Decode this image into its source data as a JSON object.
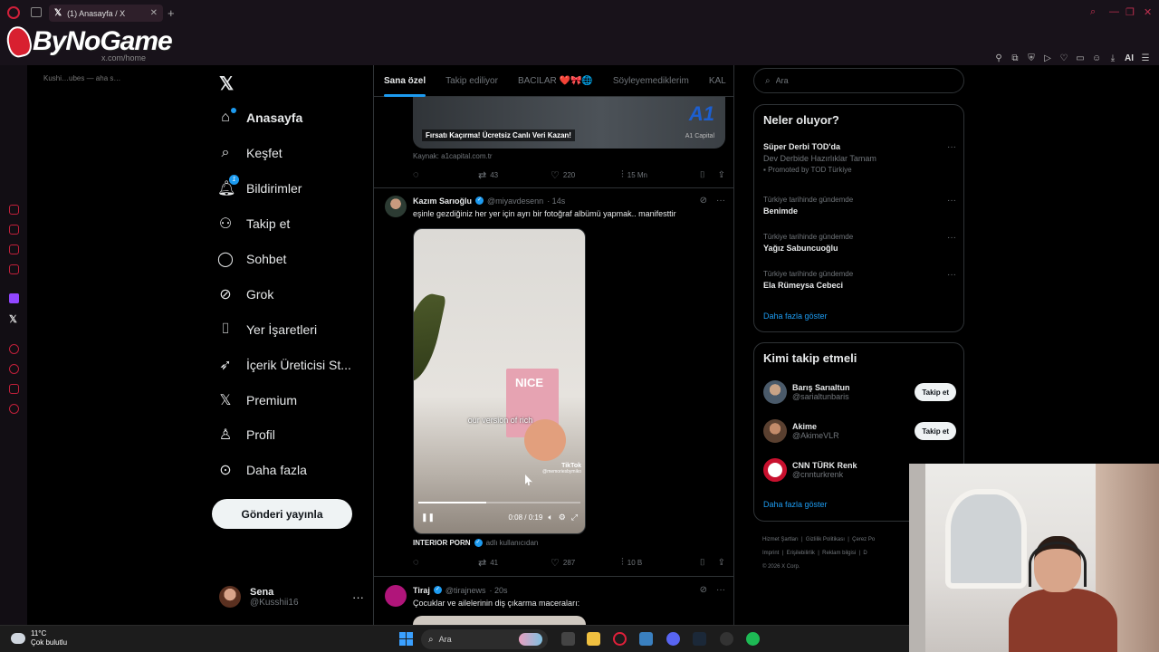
{
  "browser": {
    "tab_title": "(1) Anasayfa / X",
    "url": "x.com/home",
    "bookmark": "Kushi…ubes — aha s…",
    "brand": "ByNoGame",
    "ai_label": "AI"
  },
  "nav": {
    "items": [
      {
        "label": "Anasayfa",
        "icon": "home-icon"
      },
      {
        "label": "Keşfet",
        "icon": "search-icon"
      },
      {
        "label": "Bildirimler",
        "icon": "bell-icon",
        "badge": "1"
      },
      {
        "label": "Takip et",
        "icon": "add-person-icon"
      },
      {
        "label": "Sohbet",
        "icon": "chat-icon"
      },
      {
        "label": "Grok",
        "icon": "grok-icon"
      },
      {
        "label": "Yer İşaretleri",
        "icon": "bookmark-icon"
      },
      {
        "label": "İçerik Üreticisi St...",
        "icon": "rocket-icon"
      },
      {
        "label": "Premium",
        "icon": "x-icon"
      },
      {
        "label": "Profil",
        "icon": "person-icon"
      },
      {
        "label": "Daha fazla",
        "icon": "more-circle-icon"
      }
    ],
    "post_button": "Gönderi yayınla",
    "profile": {
      "name": "Sena",
      "handle": "@Kusshii16"
    }
  },
  "timeline": {
    "tabs": [
      "Sana özel",
      "Takip ediliyor",
      "BACILAR ❤️🎀🌐",
      "Söyleyemediklerim",
      "KAL"
    ],
    "ad": {
      "caption": "Fırsatı Kaçırma! Ücretsiz Canlı Veri Kazan!",
      "brand": "A1",
      "brand_sub": "A1 Capital",
      "source": "Kaynak: a1capital.com.tr",
      "replies": "",
      "reposts": "43",
      "likes": "220",
      "views": "15 Mn"
    },
    "tweet1": {
      "name": "Kazım Sarıoğlu",
      "handle": "@miyavdesenn",
      "time": "· 14s",
      "text": "eşinle gezdiğiniz her yer için ayrı bir fotoğraf albümü yapmak.. manifesttir",
      "video_overlay": "our version of rich",
      "video_book": "NICE",
      "tiktok": "TikTok",
      "tiktok_user": "@memoriesbymiko",
      "video_time": "0:08 / 0:19",
      "video_progress": 0.42,
      "credit_name": "INTERIOR PORN",
      "credit_sub": "adlı kullanıcıdan",
      "reposts": "41",
      "likes": "287",
      "views": "10 B"
    },
    "tweet2": {
      "name": "Tiraj",
      "handle": "@tirajnews",
      "time": "· 20s",
      "text": "Çocuklar ve ailelerinin diş çıkarma maceraları:"
    }
  },
  "right": {
    "search_placeholder": "Ara",
    "trends_title": "Neler oluyor?",
    "trends": [
      {
        "context": "",
        "title": "Süper Derbi TOD'da",
        "sub": "Dev Derbide Hazırlıklar Tamam",
        "promo": "Promoted by TOD Türkiye"
      },
      {
        "context": "Türkiye tarihinde gündemde",
        "title": "Benimde"
      },
      {
        "context": "Türkiye tarihinde gündemde",
        "title": "Yağız Sabuncuoğlu"
      },
      {
        "context": "Türkiye tarihinde gündemde",
        "title": "Ela Rümeysa Cebeci"
      }
    ],
    "show_more": "Daha fazla göster",
    "who_title": "Kimi takip etmeli",
    "who": [
      {
        "name": "Barış Sarıaltun",
        "handle": "@sarialtunbaris",
        "button": "Takip et"
      },
      {
        "name": "Akime",
        "handle": "@AkimeVLR",
        "button": "Takip et"
      },
      {
        "name": "CNN TÜRK Renk",
        "handle": "@cnnturkrenk",
        "button": ""
      }
    ],
    "footer": [
      "Hizmet Şartları",
      "Gizlilik Politikası",
      "Çerez Po",
      "Imprint",
      "Erişilebilirlik",
      "Reklam bilgisi",
      "D",
      "© 2026 X Corp."
    ]
  },
  "taskbar": {
    "temp": "11°C",
    "weather": "Çok bulutlu",
    "search": "Ara"
  },
  "colors": {
    "accent": "#1d9bf0",
    "brand_red": "#d82030"
  }
}
